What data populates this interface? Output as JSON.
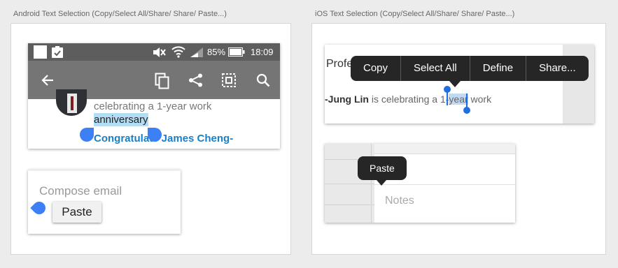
{
  "android": {
    "caption": "Android Text Selection (Copy/Select All/Share/ Share/ Paste...)",
    "status": {
      "battery_pct": "85%",
      "time": "18:09"
    },
    "feed": {
      "line1": "celebrating a 1-year work",
      "selected": "anniversary",
      "link": "Congratulate James Cheng-"
    },
    "compose": {
      "placeholder": "Compose email",
      "paste_label": "Paste"
    },
    "icons": [
      "back-arrow-icon",
      "copy-icon",
      "share-icon",
      "select-all-icon",
      "search-icon"
    ]
  },
  "ios": {
    "caption": "iOS Text Selection (Copy/Select All/Share/ Share/ Paste...)",
    "menu": [
      "Copy",
      "Select All",
      "Define",
      "Share..."
    ],
    "partial_heading": "Profe",
    "sentence": {
      "name": "-Jung Lin",
      "before": " is celebrating a 1-",
      "selected": "year",
      "after": " work"
    },
    "notes": {
      "paste_label": "Paste",
      "placeholder": "Notes"
    }
  },
  "colors": {
    "accent": "#3d7ff5",
    "link": "#1a7fc4",
    "selection": "#b3dcf5",
    "ios_menu": "#262626"
  }
}
